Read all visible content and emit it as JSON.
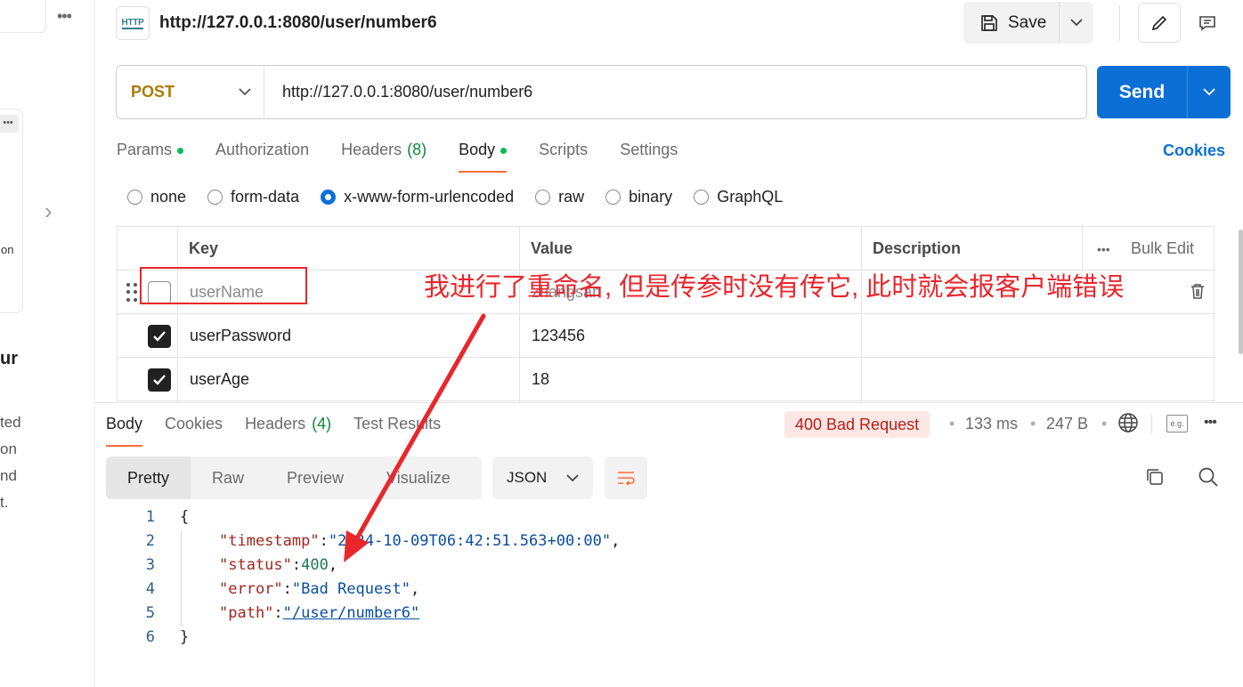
{
  "left_panel": {
    "partial_card_text": "on",
    "partial_heading": "ur",
    "partial_lines": [
      "ted",
      "on",
      "nd",
      "t."
    ]
  },
  "header": {
    "request_title": "http://127.0.0.1:8080/user/number6",
    "http_icon_text": "HTTP",
    "save_label": "Save"
  },
  "request": {
    "method": "POST",
    "url": "http://127.0.0.1:8080/user/number6",
    "send_label": "Send",
    "tabs": [
      {
        "label": "Params",
        "dot": true
      },
      {
        "label": "Authorization"
      },
      {
        "label": "Headers",
        "count": "(8)"
      },
      {
        "label": "Body",
        "dot": true,
        "active": true
      },
      {
        "label": "Scripts"
      },
      {
        "label": "Settings"
      }
    ],
    "cookies_label": "Cookies",
    "body_types": [
      "none",
      "form-data",
      "x-www-form-urlencoded",
      "raw",
      "binary",
      "GraphQL"
    ],
    "selected_body_type": "x-www-form-urlencoded"
  },
  "params_table": {
    "headers": {
      "key": "Key",
      "value": "Value",
      "description": "Description",
      "bulk_edit": "Bulk Edit"
    },
    "rows": [
      {
        "checked": false,
        "key": "userName",
        "value": "zhangsan",
        "description": ""
      },
      {
        "checked": true,
        "key": "userPassword",
        "value": "123456",
        "description": ""
      },
      {
        "checked": true,
        "key": "userAge",
        "value": "18",
        "description": ""
      }
    ]
  },
  "annotation": {
    "text": "我进行了重命名, 但是传参时没有传它, 此时就会报客户端错误",
    "color": "#e8262c"
  },
  "response": {
    "tabs": [
      {
        "label": "Body",
        "active": true
      },
      {
        "label": "Cookies"
      },
      {
        "label": "Headers",
        "count": "(4)"
      },
      {
        "label": "Test Results"
      }
    ],
    "status": "400 Bad Request",
    "time": "133 ms",
    "size": "247 B",
    "formats": [
      "Pretty",
      "Raw",
      "Preview",
      "Visualize"
    ],
    "language": "JSON",
    "code_lines": [
      {
        "num": "1"
      },
      {
        "num": "2",
        "key": "\"timestamp\"",
        "value": "\"2024-10-09T06:42:51.563+00:00\""
      },
      {
        "num": "3",
        "key": "\"status\"",
        "value": "400"
      },
      {
        "num": "4",
        "key": "\"error\"",
        "value": "\"Bad Request\""
      },
      {
        "num": "5",
        "key": "\"path\"",
        "value": "\"/user/number6\""
      },
      {
        "num": "6"
      }
    ],
    "brace_open": "{",
    "brace_close": "}",
    "example_icon_text": "e.g."
  },
  "colors": {
    "accent_blue": "#0c6fd6",
    "method_post": "#ad7a03",
    "active_tab_underline": "#ff6c37",
    "status_error_bg": "#fde7e5",
    "status_error_text": "#b41e14"
  }
}
